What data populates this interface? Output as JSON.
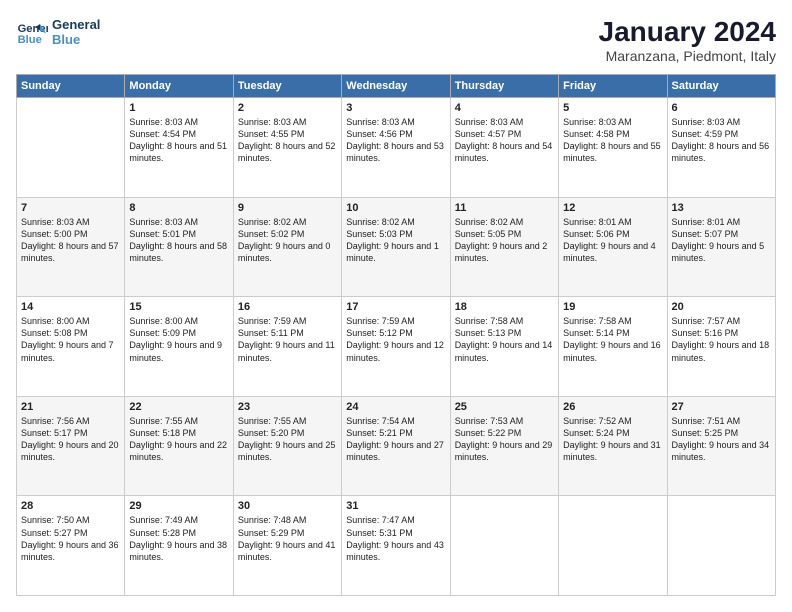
{
  "logo": {
    "line1": "General",
    "line2": "Blue"
  },
  "header": {
    "title": "January 2024",
    "location": "Maranzana, Piedmont, Italy"
  },
  "days_of_week": [
    "Sunday",
    "Monday",
    "Tuesday",
    "Wednesday",
    "Thursday",
    "Friday",
    "Saturday"
  ],
  "weeks": [
    [
      {
        "day": "",
        "sunrise": "",
        "sunset": "",
        "daylight": ""
      },
      {
        "day": "1",
        "sunrise": "Sunrise: 8:03 AM",
        "sunset": "Sunset: 4:54 PM",
        "daylight": "Daylight: 8 hours and 51 minutes."
      },
      {
        "day": "2",
        "sunrise": "Sunrise: 8:03 AM",
        "sunset": "Sunset: 4:55 PM",
        "daylight": "Daylight: 8 hours and 52 minutes."
      },
      {
        "day": "3",
        "sunrise": "Sunrise: 8:03 AM",
        "sunset": "Sunset: 4:56 PM",
        "daylight": "Daylight: 8 hours and 53 minutes."
      },
      {
        "day": "4",
        "sunrise": "Sunrise: 8:03 AM",
        "sunset": "Sunset: 4:57 PM",
        "daylight": "Daylight: 8 hours and 54 minutes."
      },
      {
        "day": "5",
        "sunrise": "Sunrise: 8:03 AM",
        "sunset": "Sunset: 4:58 PM",
        "daylight": "Daylight: 8 hours and 55 minutes."
      },
      {
        "day": "6",
        "sunrise": "Sunrise: 8:03 AM",
        "sunset": "Sunset: 4:59 PM",
        "daylight": "Daylight: 8 hours and 56 minutes."
      }
    ],
    [
      {
        "day": "7",
        "sunrise": "Sunrise: 8:03 AM",
        "sunset": "Sunset: 5:00 PM",
        "daylight": "Daylight: 8 hours and 57 minutes."
      },
      {
        "day": "8",
        "sunrise": "Sunrise: 8:03 AM",
        "sunset": "Sunset: 5:01 PM",
        "daylight": "Daylight: 8 hours and 58 minutes."
      },
      {
        "day": "9",
        "sunrise": "Sunrise: 8:02 AM",
        "sunset": "Sunset: 5:02 PM",
        "daylight": "Daylight: 9 hours and 0 minutes."
      },
      {
        "day": "10",
        "sunrise": "Sunrise: 8:02 AM",
        "sunset": "Sunset: 5:03 PM",
        "daylight": "Daylight: 9 hours and 1 minute."
      },
      {
        "day": "11",
        "sunrise": "Sunrise: 8:02 AM",
        "sunset": "Sunset: 5:05 PM",
        "daylight": "Daylight: 9 hours and 2 minutes."
      },
      {
        "day": "12",
        "sunrise": "Sunrise: 8:01 AM",
        "sunset": "Sunset: 5:06 PM",
        "daylight": "Daylight: 9 hours and 4 minutes."
      },
      {
        "day": "13",
        "sunrise": "Sunrise: 8:01 AM",
        "sunset": "Sunset: 5:07 PM",
        "daylight": "Daylight: 9 hours and 5 minutes."
      }
    ],
    [
      {
        "day": "14",
        "sunrise": "Sunrise: 8:00 AM",
        "sunset": "Sunset: 5:08 PM",
        "daylight": "Daylight: 9 hours and 7 minutes."
      },
      {
        "day": "15",
        "sunrise": "Sunrise: 8:00 AM",
        "sunset": "Sunset: 5:09 PM",
        "daylight": "Daylight: 9 hours and 9 minutes."
      },
      {
        "day": "16",
        "sunrise": "Sunrise: 7:59 AM",
        "sunset": "Sunset: 5:11 PM",
        "daylight": "Daylight: 9 hours and 11 minutes."
      },
      {
        "day": "17",
        "sunrise": "Sunrise: 7:59 AM",
        "sunset": "Sunset: 5:12 PM",
        "daylight": "Daylight: 9 hours and 12 minutes."
      },
      {
        "day": "18",
        "sunrise": "Sunrise: 7:58 AM",
        "sunset": "Sunset: 5:13 PM",
        "daylight": "Daylight: 9 hours and 14 minutes."
      },
      {
        "day": "19",
        "sunrise": "Sunrise: 7:58 AM",
        "sunset": "Sunset: 5:14 PM",
        "daylight": "Daylight: 9 hours and 16 minutes."
      },
      {
        "day": "20",
        "sunrise": "Sunrise: 7:57 AM",
        "sunset": "Sunset: 5:16 PM",
        "daylight": "Daylight: 9 hours and 18 minutes."
      }
    ],
    [
      {
        "day": "21",
        "sunrise": "Sunrise: 7:56 AM",
        "sunset": "Sunset: 5:17 PM",
        "daylight": "Daylight: 9 hours and 20 minutes."
      },
      {
        "day": "22",
        "sunrise": "Sunrise: 7:55 AM",
        "sunset": "Sunset: 5:18 PM",
        "daylight": "Daylight: 9 hours and 22 minutes."
      },
      {
        "day": "23",
        "sunrise": "Sunrise: 7:55 AM",
        "sunset": "Sunset: 5:20 PM",
        "daylight": "Daylight: 9 hours and 25 minutes."
      },
      {
        "day": "24",
        "sunrise": "Sunrise: 7:54 AM",
        "sunset": "Sunset: 5:21 PM",
        "daylight": "Daylight: 9 hours and 27 minutes."
      },
      {
        "day": "25",
        "sunrise": "Sunrise: 7:53 AM",
        "sunset": "Sunset: 5:22 PM",
        "daylight": "Daylight: 9 hours and 29 minutes."
      },
      {
        "day": "26",
        "sunrise": "Sunrise: 7:52 AM",
        "sunset": "Sunset: 5:24 PM",
        "daylight": "Daylight: 9 hours and 31 minutes."
      },
      {
        "day": "27",
        "sunrise": "Sunrise: 7:51 AM",
        "sunset": "Sunset: 5:25 PM",
        "daylight": "Daylight: 9 hours and 34 minutes."
      }
    ],
    [
      {
        "day": "28",
        "sunrise": "Sunrise: 7:50 AM",
        "sunset": "Sunset: 5:27 PM",
        "daylight": "Daylight: 9 hours and 36 minutes."
      },
      {
        "day": "29",
        "sunrise": "Sunrise: 7:49 AM",
        "sunset": "Sunset: 5:28 PM",
        "daylight": "Daylight: 9 hours and 38 minutes."
      },
      {
        "day": "30",
        "sunrise": "Sunrise: 7:48 AM",
        "sunset": "Sunset: 5:29 PM",
        "daylight": "Daylight: 9 hours and 41 minutes."
      },
      {
        "day": "31",
        "sunrise": "Sunrise: 7:47 AM",
        "sunset": "Sunset: 5:31 PM",
        "daylight": "Daylight: 9 hours and 43 minutes."
      },
      {
        "day": "",
        "sunrise": "",
        "sunset": "",
        "daylight": ""
      },
      {
        "day": "",
        "sunrise": "",
        "sunset": "",
        "daylight": ""
      },
      {
        "day": "",
        "sunrise": "",
        "sunset": "",
        "daylight": ""
      }
    ]
  ]
}
